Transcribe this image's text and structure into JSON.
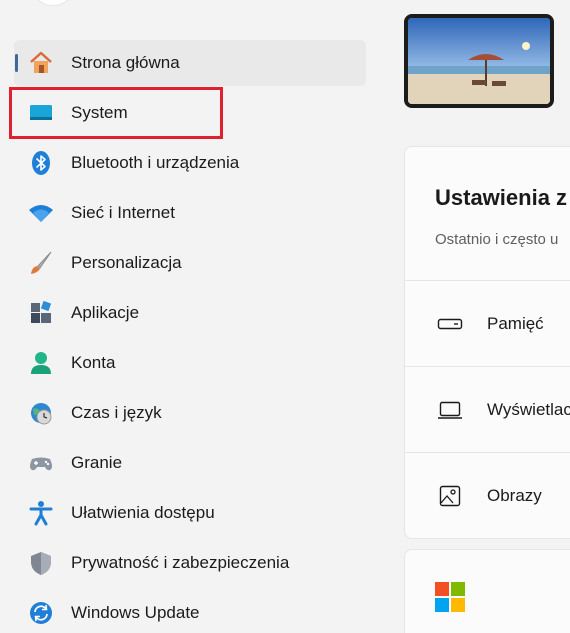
{
  "sidebar": {
    "items": [
      {
        "label": "Strona główna",
        "icon": "home-icon",
        "active": true
      },
      {
        "label": "System",
        "icon": "system-icon",
        "highlighted": true
      },
      {
        "label": "Bluetooth i urządzenia",
        "icon": "bluetooth-icon"
      },
      {
        "label": "Sieć i Internet",
        "icon": "wifi-icon"
      },
      {
        "label": "Personalizacja",
        "icon": "brush-icon"
      },
      {
        "label": "Aplikacje",
        "icon": "apps-icon"
      },
      {
        "label": "Konta",
        "icon": "account-icon"
      },
      {
        "label": "Czas i język",
        "icon": "time-language-icon"
      },
      {
        "label": "Granie",
        "icon": "gamepad-icon"
      },
      {
        "label": "Ułatwienia dostępu",
        "icon": "accessibility-icon"
      },
      {
        "label": "Prywatność i zabezpieczenia",
        "icon": "shield-icon"
      },
      {
        "label": "Windows Update",
        "icon": "update-icon"
      }
    ]
  },
  "main": {
    "recommended_card": {
      "title": "Ustawienia z",
      "subtitle": "Ostatnio i często u",
      "rows": [
        {
          "label": "Pamięć",
          "icon": "storage-icon"
        },
        {
          "label": "Wyświetlac",
          "icon": "display-icon"
        },
        {
          "label": "Obrazy",
          "icon": "image-icon"
        }
      ]
    }
  },
  "colors": {
    "accent": "#41689b",
    "highlight_box": "#e0202f",
    "background": "#f3f3f3"
  }
}
